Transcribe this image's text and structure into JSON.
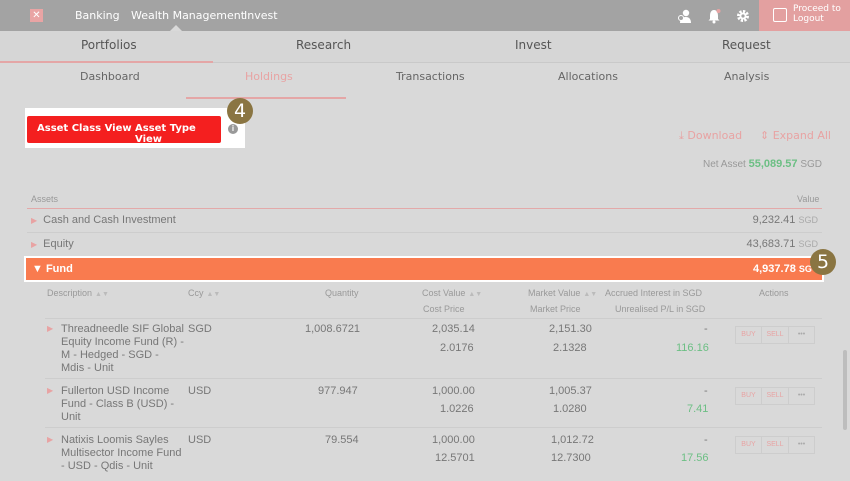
{
  "topbar": {
    "logo": "✕",
    "nav": [
      "Banking",
      "Wealth Management",
      "Invest"
    ],
    "proceed_line1": "Proceed to",
    "proceed_line2": "Logout"
  },
  "tabs_primary": [
    "Portfolios",
    "Research",
    "Invest",
    "Request"
  ],
  "tabs_secondary": [
    "Dashboard",
    "Holdings",
    "Transactions",
    "Allocations",
    "Analysis"
  ],
  "view_toggle": {
    "class_view": "Asset Class View",
    "type_view": "Asset Type View"
  },
  "badges": {
    "b4": "4",
    "b5": "5"
  },
  "actions": {
    "download": "Download",
    "expand": "Expand All"
  },
  "net_asset": {
    "label": "Net Asset",
    "value": "55,089.57",
    "ccy": "SGD"
  },
  "table": {
    "assets_label": "Assets",
    "value_label": "Value",
    "categories": [
      {
        "name": "Cash and Cash Investment",
        "value": "9,232.41",
        "ccy": "SGD"
      },
      {
        "name": "Equity",
        "value": "43,683.71",
        "ccy": "SGD"
      }
    ],
    "fund": {
      "name": "Fund",
      "value": "4,937.78",
      "ccy": "SG"
    }
  },
  "fund_columns": {
    "description": "Description",
    "ccy": "Ccy",
    "quantity": "Quantity",
    "cost_value": "Cost Value",
    "cost_price": "Cost Price",
    "market_value": "Market Value",
    "market_price": "Market Price",
    "accrued": "Accrued Interest in SGD",
    "unrealised": "Unrealised P/L in SGD",
    "actions": "Actions"
  },
  "fund_rows": [
    {
      "l1": "Threadneedle SIF Global",
      "l2": "Equity Income Fund (R) -",
      "l3": "M - Hedged - SGD -",
      "l4": "Mdis - Unit",
      "ccy": "SGD",
      "quantity": "1,008.6721",
      "cost_value": "2,035.14",
      "cost_price": "2.0176",
      "market_value": "2,151.30",
      "market_price": "2.1328",
      "accrued": "-",
      "pl": "116.16"
    },
    {
      "l1": "Fullerton USD Income",
      "l2": "Fund - Class B (USD) -",
      "l3": "Unit",
      "l4": "",
      "ccy": "USD",
      "quantity": "977.947",
      "cost_value": "1,000.00",
      "cost_price": "1.0226",
      "market_value": "1,005.37",
      "market_price": "1.0280",
      "accrued": "-",
      "pl": "7.41"
    },
    {
      "l1": "Natixis Loomis Sayles",
      "l2": "Multisector Income Fund",
      "l3": "- USD - Qdis - Unit",
      "l4": "",
      "ccy": "USD",
      "quantity": "79.554",
      "cost_value": "1,000.00",
      "cost_price": "12.5701",
      "market_value": "1,012.72",
      "market_price": "12.7300",
      "accrued": "-",
      "pl": "17.56"
    }
  ],
  "row_actions": {
    "buy": "BUY",
    "sell": "SELL",
    "more": "•••"
  }
}
